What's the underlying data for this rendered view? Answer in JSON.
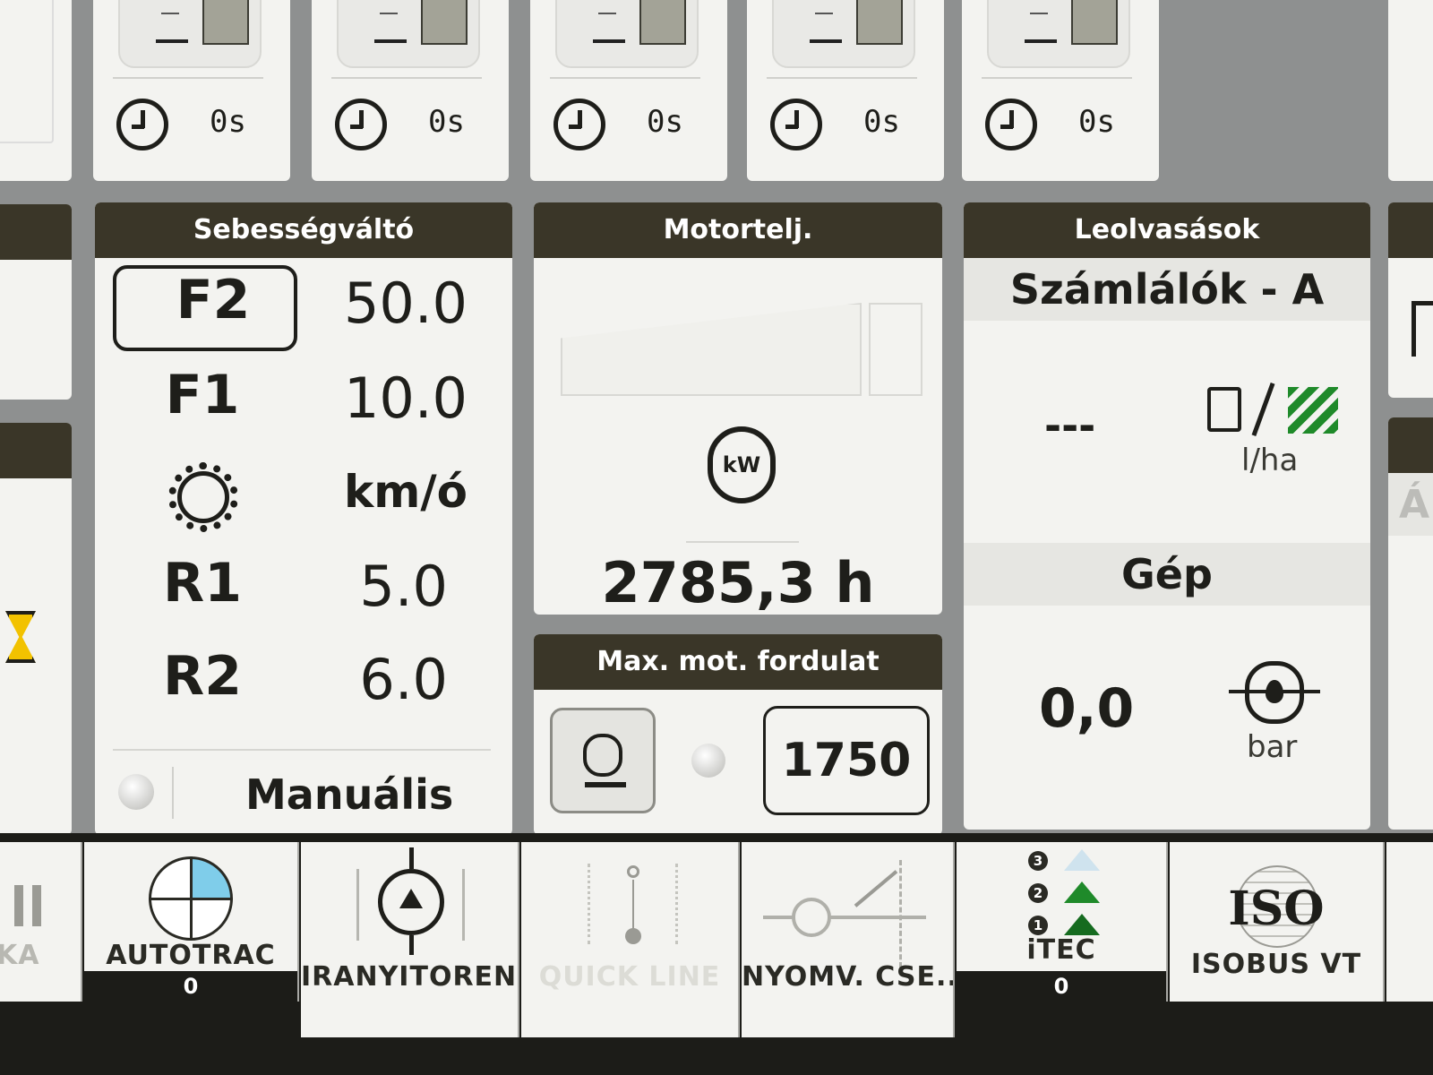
{
  "timers": [
    {
      "value": "0s"
    },
    {
      "value": "0s"
    },
    {
      "value": "0s"
    },
    {
      "value": "0s"
    },
    {
      "value": "0s"
    }
  ],
  "transmission": {
    "title": "Sebességváltó",
    "gears": [
      {
        "label": "F2",
        "value": "50.0",
        "selected": true
      },
      {
        "label": "F1",
        "value": "10.0"
      },
      {
        "label": "",
        "value": "km/ó"
      },
      {
        "label": "R1",
        "value": "5.0"
      },
      {
        "label": "R2",
        "value": "6.0"
      }
    ],
    "mode": "Manuális"
  },
  "engine_power": {
    "title": "Motortelj.",
    "unit_icon_text": "kW",
    "hours": "2785,3 h"
  },
  "max_engine_speed": {
    "title": "Max. mot. fordulat",
    "value": "1750"
  },
  "readings": {
    "title": "Leolvasások",
    "counter_name": "Számlálók - A",
    "fuel_value": "---",
    "fuel_unit": "l/ha",
    "machine_label": "Gép",
    "pressure_value": "0,0",
    "pressure_unit": "bar"
  },
  "nav": {
    "left_partial": "KA",
    "autotrac": {
      "label": "AUTOTRAC",
      "badge": "0"
    },
    "iranyitorend": {
      "label": "IRANYITOREND"
    },
    "quickline": {
      "label": "QUICK LINE"
    },
    "nyomv": {
      "label": "NYOMV. CSE..."
    },
    "itec": {
      "label": "iTEC",
      "badge": "0",
      "steps": [
        "3",
        "2",
        "1"
      ]
    },
    "isobus": {
      "label": "ISOBUS VT",
      "logo": "ISO"
    }
  },
  "right_partial": {
    "text": "Á"
  },
  "colors": {
    "header_bg": "#3a3628",
    "panel_bg": "#f3f3f0",
    "accent_green": "#1f8a2a",
    "hazard_yellow": "#f2c200",
    "autotrac_blue": "#7fcdea"
  }
}
